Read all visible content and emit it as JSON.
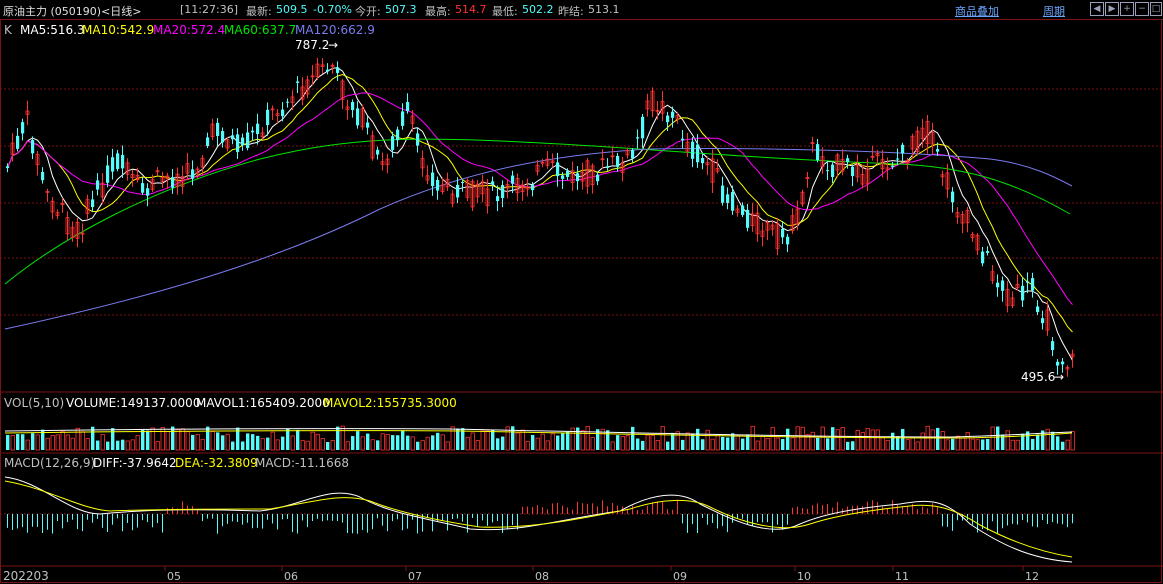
{
  "header": {
    "symbol": "原油主力 (050190)<日线>",
    "time": "[11:27:36]",
    "last_label": "最新:",
    "last": "509.5",
    "change": "-0.70%",
    "open_label": "今开:",
    "open": "507.3",
    "high_label": "最高:",
    "high": "514.7",
    "low_label": "最低:",
    "low": "502.2",
    "prev_label": "昨结:",
    "prev": "513.1",
    "overlay_link": "商品叠加",
    "period_link": "周期"
  },
  "price_panel": {
    "k_label": "K",
    "ma5": "MA5:516.3",
    "ma10": "MA10:542.9",
    "ma20": "MA20:572.4",
    "ma60": "MA60:637.7",
    "ma120": "MA120:662.9",
    "high_mark": "787.2",
    "low_mark": "495.6"
  },
  "volume_panel": {
    "vol_label": "VOL(5,10)",
    "volume": "VOLUME:149137.0000",
    "mavol1": "MAVOL1:165409.2000",
    "mavol2": "MAVOL2:155735.3000"
  },
  "macd_panel": {
    "macd_label": "MACD(12,26,9)",
    "diff": "DIFF:-37.9642",
    "dea": "DEA:-32.3809",
    "macd": "MACD:-11.1668"
  },
  "x_axis": {
    "start": "202203",
    "months": [
      "05",
      "06",
      "07",
      "08",
      "09",
      "10",
      "11",
      "12"
    ]
  },
  "colors": {
    "up": "#ff3232",
    "down": "#54fcfc",
    "ma5": "#ffffff",
    "ma10": "#ffff00",
    "ma20": "#ff00ff",
    "ma60": "#00e600",
    "ma120": "#7b7bf0",
    "grid": "#7a1414"
  }
}
